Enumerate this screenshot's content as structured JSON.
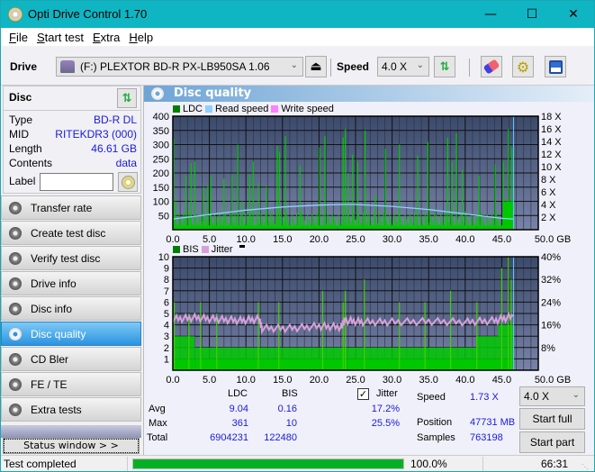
{
  "window": {
    "title": "Opti Drive Control 1.70",
    "controls": {
      "minimize": "—",
      "maximize": "☐",
      "close": "✕"
    }
  },
  "menu": [
    {
      "label": "File",
      "accel": "F",
      "rest": "ile"
    },
    {
      "label": "Start test",
      "accel": "S",
      "rest": "tart test"
    },
    {
      "label": "Extra",
      "accel": "E",
      "rest": "xtra",
      "accel_pos": 1
    },
    {
      "label": "Help",
      "accel": "H",
      "rest": "elp"
    }
  ],
  "toolbar": {
    "drive_label": "Drive",
    "drive_value": "(F:)  PLEXTOR BD-R  PX-LB950SA 1.06",
    "speed_label": "Speed",
    "speed_value": "4.0 X",
    "icons": [
      "drive-icon",
      "eject-icon",
      "swap-icon",
      "eraser-icon",
      "gear-icon",
      "save-icon"
    ]
  },
  "disc": {
    "header": "Disc",
    "fields": [
      {
        "key": "Type",
        "value": "BD-R DL"
      },
      {
        "key": "MID",
        "value": "RITEKDR3 (000)"
      },
      {
        "key": "Length",
        "value": "46.61 GB"
      },
      {
        "key": "Contents",
        "value": "data"
      }
    ],
    "label_key": "Label",
    "label_value": ""
  },
  "nav": {
    "items": [
      {
        "label": "Transfer rate",
        "active": false
      },
      {
        "label": "Create test disc",
        "active": false
      },
      {
        "label": "Verify test disc",
        "active": false
      },
      {
        "label": "Drive info",
        "active": false
      },
      {
        "label": "Disc info",
        "active": false
      },
      {
        "label": "Disc quality",
        "active": true
      },
      {
        "label": "CD Bler",
        "active": false
      },
      {
        "label": "FE / TE",
        "active": false
      },
      {
        "label": "Extra tests",
        "active": false
      }
    ],
    "status_window": "Status window > >"
  },
  "panel": {
    "title": "Disc quality"
  },
  "colors": {
    "plot_bg_top": "#3b4a6b",
    "plot_bg_bottom": "#7783a8",
    "ldc": "#00c800",
    "read_speed": "#8fd0ff",
    "write_speed": "#ff80ff",
    "bis": "#00c800",
    "jitter": "#d8a0d8",
    "value_text": "#1a1adc",
    "progress": "#06b025"
  },
  "chart_data": [
    {
      "type": "bar",
      "title": "LDC / Read speed",
      "legend": [
        "LDC",
        "Read speed",
        "Write speed"
      ],
      "legend_placement": "top-left",
      "xlabel": "GB",
      "xlim": [
        0,
        50
      ],
      "x_ticks": [
        "0.0",
        "5.0",
        "10.0",
        "15.0",
        "20.0",
        "25.0",
        "30.0",
        "35.0",
        "40.0",
        "45.0",
        "50.0 GB"
      ],
      "ylim_left": [
        0,
        400
      ],
      "y_ticks_left": [
        "400",
        "350",
        "300",
        "250",
        "200",
        "150",
        "100",
        "50"
      ],
      "ylim_right": [
        0,
        18
      ],
      "y_ticks_right": [
        "18 X",
        "16 X",
        "14 X",
        "12 X",
        "10 X",
        "8 X",
        "6 X",
        "4 X",
        "2 X"
      ],
      "grid": true,
      "disc_end_gb": 46.61,
      "ldc_spikes": [
        {
          "x": 0.1,
          "y": 320
        },
        {
          "x": 0.4,
          "y": 100
        },
        {
          "x": 1.8,
          "y": 190
        },
        {
          "x": 2.5,
          "y": 235
        },
        {
          "x": 3.0,
          "y": 240
        },
        {
          "x": 4.2,
          "y": 150
        },
        {
          "x": 4.8,
          "y": 155
        },
        {
          "x": 5.2,
          "y": 190
        },
        {
          "x": 7.0,
          "y": 180
        },
        {
          "x": 8.1,
          "y": 195
        },
        {
          "x": 8.9,
          "y": 300
        },
        {
          "x": 9.5,
          "y": 100
        },
        {
          "x": 10.5,
          "y": 195
        },
        {
          "x": 11.0,
          "y": 240
        },
        {
          "x": 11.7,
          "y": 165
        },
        {
          "x": 12.8,
          "y": 150
        },
        {
          "x": 14.3,
          "y": 295
        },
        {
          "x": 14.6,
          "y": 275
        },
        {
          "x": 15.4,
          "y": 330
        },
        {
          "x": 17.4,
          "y": 225
        },
        {
          "x": 20.1,
          "y": 290
        },
        {
          "x": 20.8,
          "y": 330
        },
        {
          "x": 23.3,
          "y": 325
        },
        {
          "x": 23.6,
          "y": 355
        },
        {
          "x": 24.0,
          "y": 200
        },
        {
          "x": 24.6,
          "y": 265
        },
        {
          "x": 25.3,
          "y": 240
        },
        {
          "x": 26.3,
          "y": 350
        },
        {
          "x": 27.7,
          "y": 120
        },
        {
          "x": 29.1,
          "y": 285
        },
        {
          "x": 31.0,
          "y": 300
        },
        {
          "x": 33.5,
          "y": 260
        },
        {
          "x": 34.9,
          "y": 310
        },
        {
          "x": 37.6,
          "y": 325
        },
        {
          "x": 38.2,
          "y": 240
        },
        {
          "x": 38.8,
          "y": 340
        },
        {
          "x": 39.6,
          "y": 210
        },
        {
          "x": 41.9,
          "y": 190
        },
        {
          "x": 44.1,
          "y": 230
        },
        {
          "x": 45.2,
          "y": 240
        },
        {
          "x": 45.9,
          "y": 355
        },
        {
          "x": 46.4,
          "y": 290
        }
      ],
      "ldc_baseline": 15,
      "read_speed": [
        {
          "x": 0,
          "y": 1.7
        },
        {
          "x": 5,
          "y": 2.4
        },
        {
          "x": 10,
          "y": 3.1
        },
        {
          "x": 15,
          "y": 3.6
        },
        {
          "x": 20,
          "y": 3.9
        },
        {
          "x": 23.3,
          "y": 4.0
        },
        {
          "x": 25,
          "y": 4.0
        },
        {
          "x": 30,
          "y": 3.7
        },
        {
          "x": 35,
          "y": 3.2
        },
        {
          "x": 40,
          "y": 2.5
        },
        {
          "x": 45,
          "y": 1.8
        },
        {
          "x": 46.61,
          "y": 1.7
        }
      ]
    },
    {
      "type": "bar",
      "title": "BIS / Jitter",
      "legend": [
        "BIS",
        "Jitter"
      ],
      "legend_placement": "top-left",
      "xlabel": "GB",
      "xlim": [
        0,
        50
      ],
      "x_ticks": [
        "0.0",
        "5.0",
        "10.0",
        "15.0",
        "20.0",
        "25.0",
        "30.0",
        "35.0",
        "40.0",
        "45.0",
        "50.0 GB"
      ],
      "ylim_left": [
        0,
        10
      ],
      "y_ticks_left": [
        "10",
        "9",
        "8",
        "7",
        "6",
        "5",
        "4",
        "3",
        "2",
        "1"
      ],
      "ylim_right": [
        0,
        40
      ],
      "y_ticks_right": [
        "40%",
        "32%",
        "24%",
        "16%",
        "8%"
      ],
      "grid": true,
      "bis_levels": [
        {
          "x0": 0,
          "x1": 3,
          "y": 3
        },
        {
          "x0": 3,
          "x1": 24,
          "y": 2
        },
        {
          "x0": 24,
          "x1": 41.5,
          "y": 2
        },
        {
          "x0": 41.5,
          "x1": 44.5,
          "y": 3
        },
        {
          "x0": 44.5,
          "x1": 46.61,
          "y": 4
        }
      ],
      "bis_spikes": [
        {
          "x": 0.2,
          "y": 6
        },
        {
          "x": 2.2,
          "y": 5
        },
        {
          "x": 3.8,
          "y": 6
        },
        {
          "x": 6.0,
          "y": 5
        },
        {
          "x": 11.7,
          "y": 6
        },
        {
          "x": 14.5,
          "y": 6
        },
        {
          "x": 20.5,
          "y": 7
        },
        {
          "x": 23.3,
          "y": 6
        },
        {
          "x": 23.6,
          "y": 7
        },
        {
          "x": 26.2,
          "y": 8
        },
        {
          "x": 31.0,
          "y": 6
        },
        {
          "x": 34.5,
          "y": 6
        },
        {
          "x": 38.0,
          "y": 7
        },
        {
          "x": 41.6,
          "y": 6
        },
        {
          "x": 45.0,
          "y": 9
        },
        {
          "x": 45.9,
          "y": 10
        },
        {
          "x": 46.3,
          "y": 8
        }
      ],
      "jitter": [
        {
          "x": 0,
          "y": 18.0
        },
        {
          "x": 3,
          "y": 18.5
        },
        {
          "x": 6,
          "y": 18.0
        },
        {
          "x": 9,
          "y": 17.5
        },
        {
          "x": 11.8,
          "y": 18.0
        },
        {
          "x": 12.2,
          "y": 14.8
        },
        {
          "x": 16,
          "y": 14.8
        },
        {
          "x": 20,
          "y": 15.5
        },
        {
          "x": 23,
          "y": 15.2
        },
        {
          "x": 23.5,
          "y": 17.5
        },
        {
          "x": 26,
          "y": 17.0
        },
        {
          "x": 30,
          "y": 17.0
        },
        {
          "x": 35,
          "y": 17.2
        },
        {
          "x": 40,
          "y": 17.0
        },
        {
          "x": 44,
          "y": 17.5
        },
        {
          "x": 46.61,
          "y": 19.0
        }
      ]
    }
  ],
  "stats": {
    "col_ldc": "LDC",
    "col_bis": "BIS",
    "row_avg": "Avg",
    "row_max": "Max",
    "row_total": "Total",
    "ldc_avg": "9.04",
    "ldc_max": "361",
    "ldc_total": "6904231",
    "bis_avg": "0.16",
    "bis_max": "10",
    "bis_total": "122480",
    "jitter_label": "Jitter",
    "jitter_checked": true,
    "jitter_avg": "17.2%",
    "jitter_max": "25.5%",
    "speed_label": "Speed",
    "speed_value": "1.73 X",
    "position_label": "Position",
    "position_value": "47731 MB",
    "samples_label": "Samples",
    "samples_value": "763198",
    "speed_select": "4.0 X",
    "start_full": "Start full",
    "start_part": "Start part"
  },
  "statusbar": {
    "text": "Test completed",
    "progress_fraction": 1.0,
    "progress_text": "100.0%",
    "time": "66:31"
  }
}
